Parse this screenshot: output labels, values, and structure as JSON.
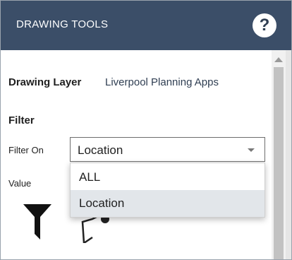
{
  "header": {
    "title": "DRAWING TOOLS",
    "help_label": "?"
  },
  "drawing_layer": {
    "label": "Drawing Layer",
    "value": "Liverpool Planning Apps"
  },
  "filter": {
    "heading": "Filter",
    "filter_on_label": "Filter On",
    "selected": "Location",
    "options": [
      "ALL",
      "Location"
    ],
    "highlighted_option": "Location",
    "value_label": "Value"
  },
  "icons": {
    "filter_tool": "funnel-icon",
    "draw_tool": "draw-shape-icon",
    "help": "help-icon"
  },
  "colors": {
    "header_bg": "#3b4e68",
    "accent_text": "#2f3e52",
    "highlight": "#e2e6ea"
  }
}
